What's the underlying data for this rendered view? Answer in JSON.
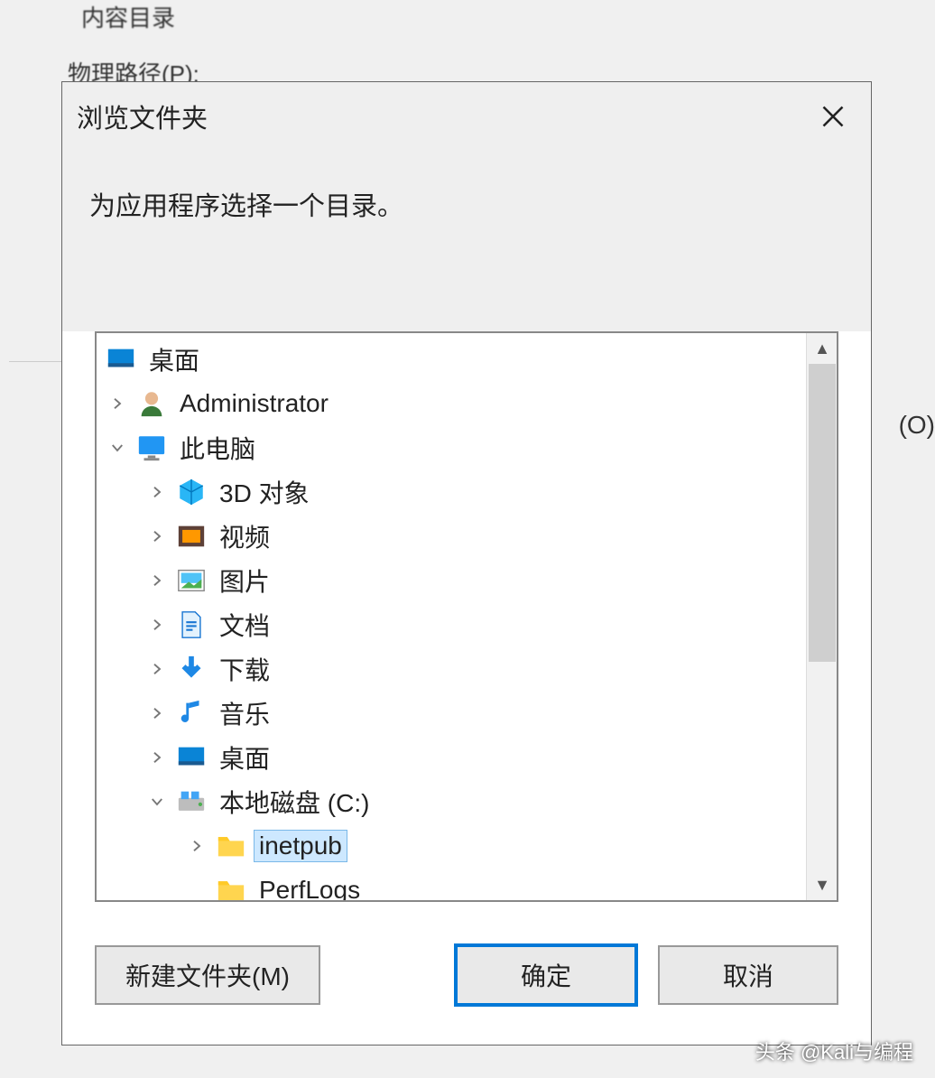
{
  "background": {
    "section_label_partial": "内容目录",
    "physical_path_label": "物理路径(P):",
    "right_fragment": "(O)"
  },
  "dialog": {
    "title": "浏览文件夹",
    "instruction": "为应用程序选择一个目录。",
    "tree": {
      "root": {
        "label": "桌面",
        "icon": "desktop"
      },
      "admin": {
        "label": "Administrator",
        "icon": "user"
      },
      "pc": {
        "label": "此电脑",
        "icon": "monitor"
      },
      "threeD": {
        "label": "3D 对象",
        "icon": "cube"
      },
      "videos": {
        "label": "视频",
        "icon": "film"
      },
      "pictures": {
        "label": "图片",
        "icon": "picture"
      },
      "documents": {
        "label": "文档",
        "icon": "doc"
      },
      "downloads": {
        "label": "下载",
        "icon": "download"
      },
      "music": {
        "label": "音乐",
        "icon": "music"
      },
      "desktop": {
        "label": "桌面",
        "icon": "desktop2"
      },
      "drive": {
        "label": "本地磁盘 (C:)",
        "icon": "drive"
      },
      "inetpub": {
        "label": "inetpub",
        "icon": "folder"
      },
      "perflogs": {
        "label": "PerfLogs",
        "icon": "folder"
      }
    },
    "buttons": {
      "mkdir": "新建文件夹(M)",
      "ok": "确定",
      "cancel": "取消"
    }
  },
  "watermark": "头条 @Kali与编程"
}
